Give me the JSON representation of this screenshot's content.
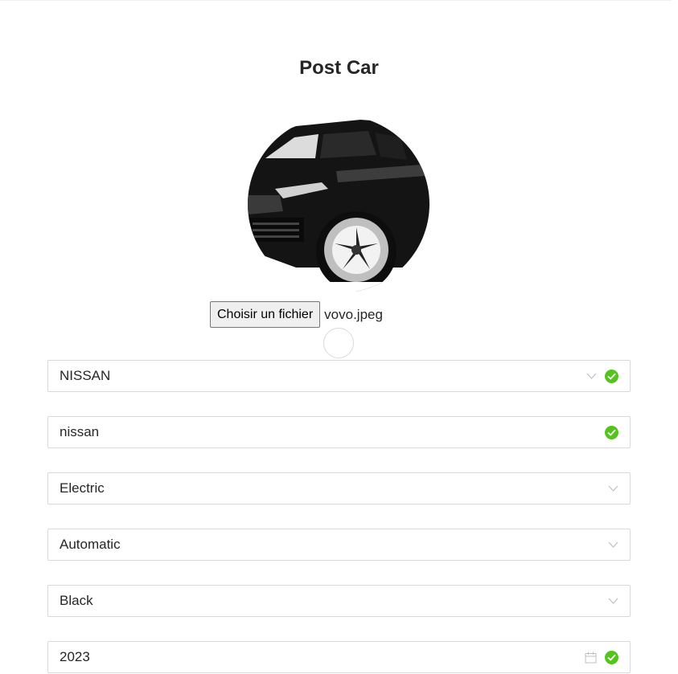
{
  "page": {
    "title": "Post Car"
  },
  "upload": {
    "button_label": "Choisir un fichier",
    "file_name": "vovo.jpeg"
  },
  "form": {
    "brand": {
      "value": "NISSAN",
      "status": "valid"
    },
    "model": {
      "value": "nissan",
      "status": "valid"
    },
    "fuel": {
      "value": "Electric"
    },
    "transmission": {
      "value": "Automatic"
    },
    "color": {
      "value": "Black"
    },
    "year": {
      "value": "2023",
      "status": "valid"
    }
  },
  "icons": {
    "dropdown": "chevron-down-icon",
    "valid": "check-circle-icon",
    "date": "calendar-icon"
  },
  "colors": {
    "success": "#52c41a",
    "border": "#d9d9d9",
    "text": "#262626"
  }
}
